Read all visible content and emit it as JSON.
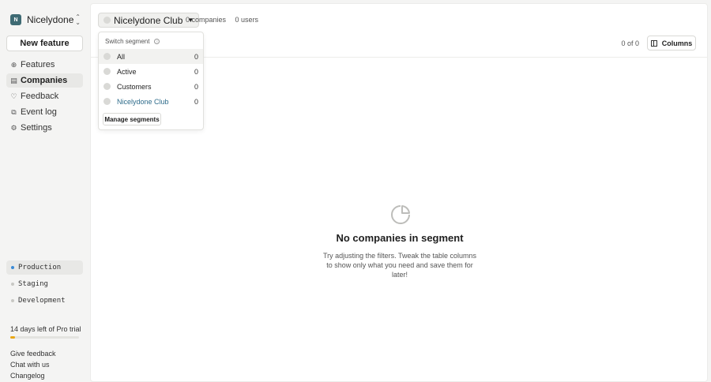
{
  "org": {
    "initial": "N",
    "name": "Nicelydone"
  },
  "sidebar": {
    "new_feature_label": "New feature",
    "items": [
      {
        "label": "Features",
        "icon": "features-icon",
        "active": false
      },
      {
        "label": "Companies",
        "icon": "companies-icon",
        "active": true
      },
      {
        "label": "Feedback",
        "icon": "feedback-icon",
        "active": false
      },
      {
        "label": "Event log",
        "icon": "event-log-icon",
        "active": false
      },
      {
        "label": "Settings",
        "icon": "settings-icon",
        "active": false
      }
    ],
    "environments": [
      {
        "label": "Production",
        "color": "#3a8ad6",
        "active": true
      },
      {
        "label": "Staging",
        "color": "#c8c8c4",
        "active": false
      },
      {
        "label": "Development",
        "color": "#c8c8c4",
        "active": false
      }
    ],
    "trial_text": "14 days left of Pro trial",
    "trial_progress_percent": 7,
    "footer_links": [
      "Give feedback",
      "Chat with us",
      "Changelog"
    ]
  },
  "topbar": {
    "segment_label": "Nicelydone Club",
    "companies_count": "0 companies",
    "users_count": "0 users",
    "pager": "0 of 0",
    "columns_label": "Columns"
  },
  "dropdown": {
    "header": "Switch segment",
    "items": [
      {
        "label": "All",
        "count": "0"
      },
      {
        "label": "Active",
        "count": "0"
      },
      {
        "label": "Customers",
        "count": "0"
      },
      {
        "label": "Nicelydone Club",
        "count": "0"
      }
    ],
    "manage_label": "Manage segments"
  },
  "empty_state": {
    "title": "No companies in segment",
    "description": "Try adjusting the filters. Tweak the table columns to show only what you need and save them for later!"
  },
  "colors": {
    "accent": "#2d6b8a",
    "trial_fill": "#e9a716",
    "production_dot": "#3a8ad6"
  }
}
